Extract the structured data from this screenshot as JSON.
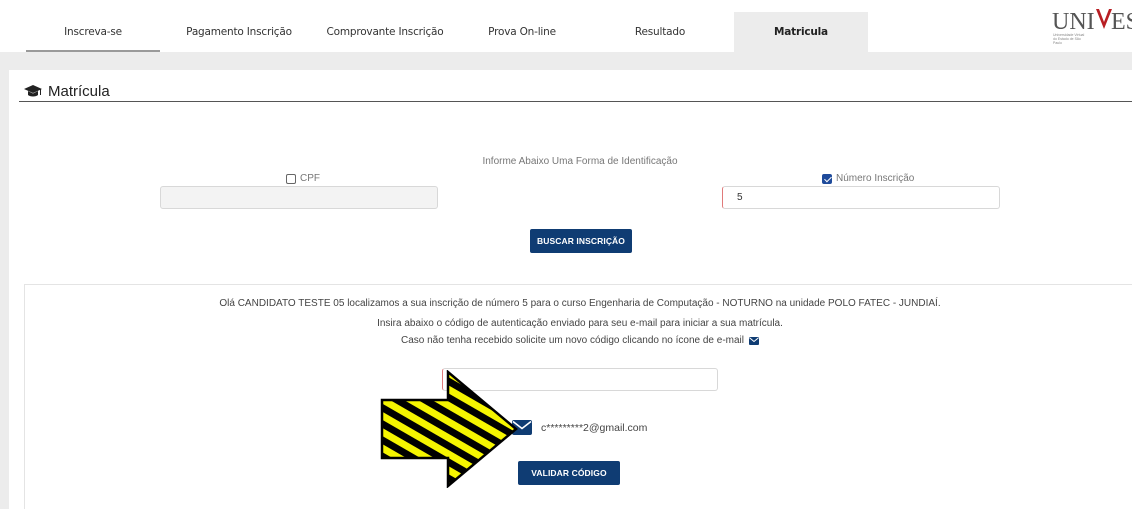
{
  "nav": {
    "tabs": [
      {
        "label": "Inscreva-se"
      },
      {
        "label": "Pagamento Inscrição"
      },
      {
        "label": "Comprovante Inscrição"
      },
      {
        "label": "Prova On-line"
      },
      {
        "label": "Resultado"
      },
      {
        "label": "Matricula"
      }
    ],
    "active_tab": "Matricula",
    "logo_text": "UNIVESP",
    "logo_subtitle": "Universidade Virtual do Estado de São Paulo"
  },
  "section": {
    "icon": "graduation-cap-icon",
    "title": "Matrícula"
  },
  "identification": {
    "prompt": "Informe Abaixo Uma Forma de Identificação",
    "cpf_label": "CPF",
    "cpf_checked": false,
    "cpf_value": "",
    "numero_label": "Número Inscrição",
    "numero_checked": true,
    "numero_value": "5",
    "search_button": "BUSCAR INSCRIÇÃO"
  },
  "result": {
    "greeting": "Olá CANDIDATO TESTE 05 localizamos a sua inscrição de número 5 para o curso Engenharia de Computação - NOTURNO na unidade POLO FATEC - JUNDIAÍ.",
    "instruction": "Insira abaixo o código de autenticação enviado para seu e-mail para iniciar a sua matrícula.",
    "resend_hint": "Caso não tenha recebido solicite um novo código clicando no ícone de e-mail",
    "code_value": "",
    "masked_email": "c*********2@gmail.com",
    "validate_button": "VALIDAR CÓDIGO"
  },
  "colors": {
    "primary_button": "#0f3c73",
    "checkbox_checked": "#1f4b9b",
    "arrow_yellow": "#f5f500",
    "arrow_black": "#000000"
  }
}
